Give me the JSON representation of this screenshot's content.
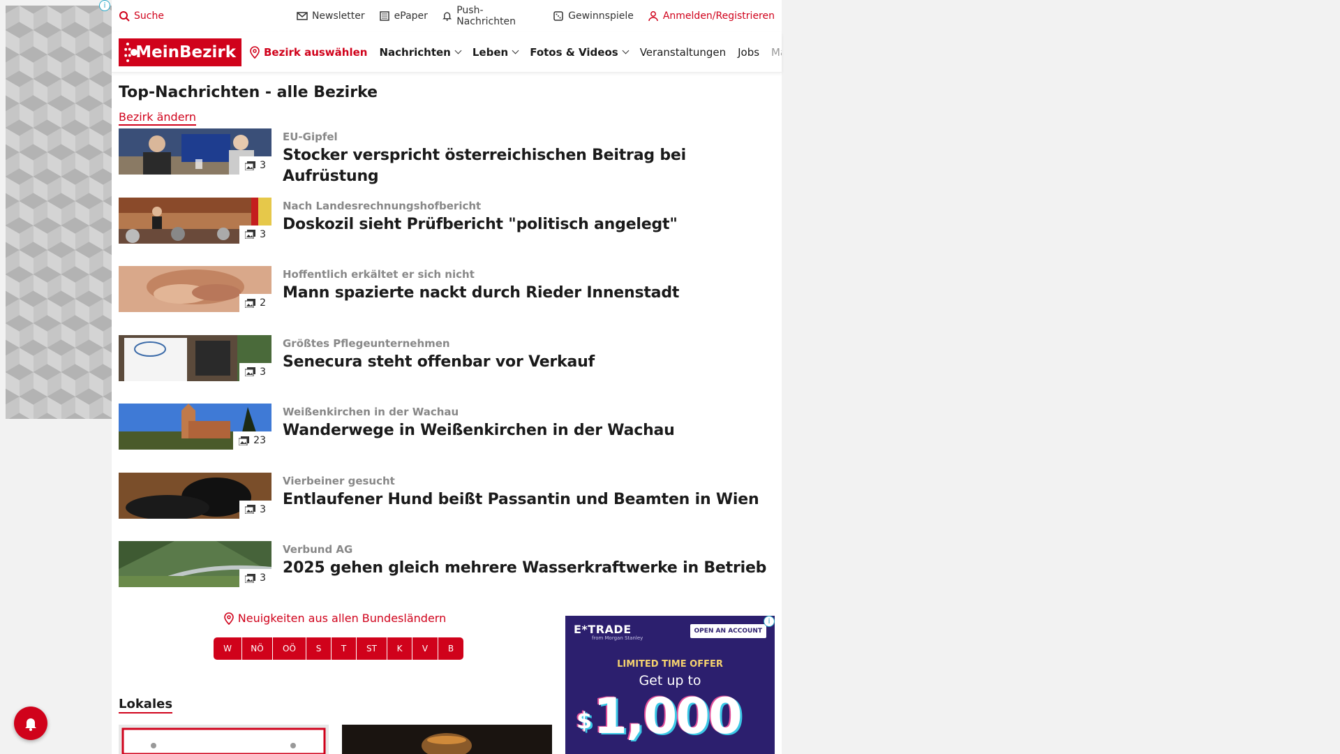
{
  "ad_info": "i",
  "utility": {
    "search": "Suche",
    "newsletter": "Newsletter",
    "epaper": "ePaper",
    "push": "Push-Nachrichten",
    "gewinnspiele": "Gewinnspiele",
    "login": "Anmelden/Registrieren"
  },
  "nav": {
    "logo": "MeinBezirk",
    "bezirk_select": "Bezirk auswählen",
    "items": [
      "Nachrichten",
      "Leben",
      "Fotos & Videos",
      "Veranstaltungen",
      "Jobs",
      "Marktplatz"
    ]
  },
  "top_news": {
    "title": "Top-Nachrichten - alle Bezirke",
    "change_label": "Bezirk ändern",
    "articles": [
      {
        "kicker": "EU-Gipfel",
        "headline": "Stocker verspricht österreichischen Beitrag bei Aufrüstung",
        "photos": "3"
      },
      {
        "kicker": "Nach Landesrechnungshofbericht",
        "headline": "Doskozil sieht Prüfbericht \"politisch angelegt\"",
        "photos": "3"
      },
      {
        "kicker": "Hoffentlich erkältet er sich nicht",
        "headline": "Mann spazierte nackt durch Rieder Innenstadt",
        "photos": "2"
      },
      {
        "kicker": "Größtes Pflegeunternehmen",
        "headline": "Senecura steht offenbar vor Verkauf",
        "photos": "3"
      },
      {
        "kicker": "Weißenkirchen in der Wachau",
        "headline": "Wanderwege in Weißenkirchen in der Wachau",
        "photos": "23"
      },
      {
        "kicker": "Vierbeiner gesucht",
        "headline": "Entlaufener Hund beißt Passantin und Beamten in Wien",
        "photos": "3"
      },
      {
        "kicker": "Verbund AG",
        "headline": "2025 gehen gleich mehrere Wasserkraftwerke in Betrieb",
        "photos": "3"
      }
    ]
  },
  "states": {
    "title": "Neuigkeiten aus allen Bundesländern",
    "buttons": [
      "W",
      "NÖ",
      "OÖ",
      "S",
      "T",
      "ST",
      "K",
      "V",
      "B"
    ]
  },
  "lokales": {
    "title": "Lokales"
  },
  "ad_right": {
    "logo": "E*TRADE",
    "sub": "from Morgan Stanley",
    "cta": "OPEN AN ACCOUNT",
    "limited": "LIMITED TIME OFFER",
    "getup": "Get up to",
    "dollar": "$",
    "amount": "1,000",
    "info": "i"
  },
  "colors": {
    "brand": "#d0021b",
    "kicker": "#888888"
  }
}
